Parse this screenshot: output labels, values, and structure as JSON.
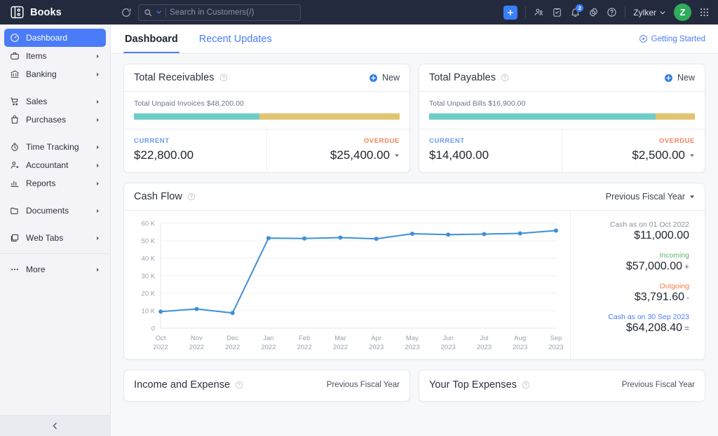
{
  "topbar": {
    "brand": "Books",
    "brand_logo_icon": "books-logo-icon",
    "refresh_icon": "refresh-icon",
    "search": {
      "placeholder": "Search in Customers(/)",
      "value": "",
      "search_icon": "search-icon",
      "dropdown_icon": "chevron-down-icon"
    },
    "add_icon": "plus-icon",
    "icons": [
      {
        "name": "contacts-icon"
      },
      {
        "name": "clipboard-icon"
      },
      {
        "name": "bell-icon",
        "badge": "2"
      },
      {
        "name": "settings-gear-icon"
      },
      {
        "name": "help-circle-icon"
      }
    ],
    "org_name": "Zylker",
    "org_caret_icon": "chevron-down-icon",
    "avatar_initial": "Z",
    "apps_grid_icon": "apps-grid-icon"
  },
  "sidebar": {
    "items": [
      {
        "label": "Dashboard",
        "icon": "gauge-icon",
        "active": true,
        "arrow": false,
        "gap_after": false
      },
      {
        "label": "Items",
        "icon": "briefcase-icon",
        "active": false,
        "arrow": true,
        "gap_after": false
      },
      {
        "label": "Banking",
        "icon": "bank-icon",
        "active": false,
        "arrow": true,
        "gap_after": true
      },
      {
        "label": "Sales",
        "icon": "cart-icon",
        "active": false,
        "arrow": true,
        "gap_after": false
      },
      {
        "label": "Purchases",
        "icon": "shopping-bag-icon",
        "active": false,
        "arrow": true,
        "gap_after": true
      },
      {
        "label": "Time Tracking",
        "icon": "stopwatch-icon",
        "active": false,
        "arrow": true,
        "gap_after": false
      },
      {
        "label": "Accountant",
        "icon": "user-plus-icon",
        "active": false,
        "arrow": true,
        "gap_after": false
      },
      {
        "label": "Reports",
        "icon": "bar-chart-icon",
        "active": false,
        "arrow": true,
        "gap_after": true
      },
      {
        "label": "Documents",
        "icon": "folder-icon",
        "active": false,
        "arrow": true,
        "gap_after": true
      },
      {
        "label": "Web Tabs",
        "icon": "window-icon",
        "active": false,
        "arrow": true,
        "gap_after": false
      }
    ],
    "more": {
      "label": "More",
      "icon": "ellipsis-icon",
      "arrow": true
    },
    "collapse_icon": "chevron-left-icon"
  },
  "tabs": {
    "items": [
      {
        "label": "Dashboard",
        "active": true
      },
      {
        "label": "Recent Updates",
        "active": false
      }
    ],
    "getting_started": {
      "label": "Getting Started",
      "icon": "play-circle-icon"
    }
  },
  "receivables": {
    "title": "Total Receivables",
    "help_icon": "help-circle-icon",
    "new_label": "New",
    "new_icon": "plus-circle-icon",
    "bar_label": "Total Unpaid Invoices $48,200.00",
    "bar_total": 48200,
    "current": {
      "label": "CURRENT",
      "value": "$22,800.00",
      "amount": 22800
    },
    "overdue": {
      "label": "OVERDUE",
      "value": "$25,400.00",
      "amount": 25400,
      "caret_icon": "chevron-down-icon"
    },
    "colors": {
      "current_bar": "#6ecdc8",
      "overdue_bar": "#e2c572",
      "current_text": "#6a9bf0",
      "overdue_text": "#f2845d"
    }
  },
  "payables": {
    "title": "Total Payables",
    "help_icon": "help-circle-icon",
    "new_label": "New",
    "new_icon": "plus-circle-icon",
    "bar_label": "Total Unpaid Bills $16,900.00",
    "bar_total": 16900,
    "current": {
      "label": "CURRENT",
      "value": "$14,400.00",
      "amount": 14400
    },
    "overdue": {
      "label": "OVERDUE",
      "value": "$2,500.00",
      "amount": 2500,
      "caret_icon": "chevron-down-icon"
    },
    "colors": {
      "current_bar": "#6ecdc8",
      "overdue_bar": "#e2c572"
    }
  },
  "cashflow": {
    "title": "Cash Flow",
    "help_icon": "help-circle-icon",
    "period": "Previous Fiscal Year",
    "period_caret_icon": "chevron-down-icon",
    "summary": {
      "opening_label": "Cash as on 01 Oct 2022",
      "opening_value": "$11,000.00",
      "incoming_label": "Incoming",
      "incoming_value": "$57,000.00",
      "incoming_sign": "+",
      "outgoing_label": "Outgoing",
      "outgoing_value": "$3,791.60",
      "outgoing_sign": "-",
      "closing_label": "Cash as on 30 Sep 2023",
      "closing_value": "$64,208.40",
      "closing_sign": "="
    }
  },
  "chart_data": {
    "type": "line",
    "title": "Cash Flow",
    "xlabel": "",
    "ylabel": "",
    "ylim": [
      0,
      60000
    ],
    "yticks": [
      0,
      10000,
      20000,
      30000,
      40000,
      50000,
      60000
    ],
    "ytick_labels": [
      "0",
      "10 K",
      "20 K",
      "30 K",
      "40 K",
      "50 K",
      "60 K"
    ],
    "grid": true,
    "legend": false,
    "line_color": "#3d90d7",
    "categories": [
      "Oct\n2022",
      "Nov\n2022",
      "Dec\n2022",
      "Jan\n2022",
      "Feb\n2022",
      "Mar\n2022",
      "Apr\n2023",
      "May\n2023",
      "Jun\n2023",
      "Jul\n2023",
      "Aug\n2023",
      "Sep\n2023"
    ],
    "tick_labels_top": [
      "Oct",
      "Nov",
      "Dec",
      "Jan",
      "Feb",
      "Mar",
      "Apr",
      "May",
      "Jun",
      "Jul",
      "Aug",
      "Sep"
    ],
    "tick_labels_bottom": [
      "2022",
      "2022",
      "2022",
      "2022",
      "2022",
      "2022",
      "2023",
      "2023",
      "2023",
      "2023",
      "2023",
      "2023"
    ],
    "series": [
      {
        "name": "Cash Flow",
        "values": [
          9500,
          11000,
          8700,
          51500,
          51300,
          51800,
          51100,
          54000,
          53500,
          53800,
          54200,
          55800,
          56000
        ]
      }
    ],
    "values": [
      9500,
      11000,
      8700,
      51500,
      51300,
      51800,
      51100,
      54000,
      53500,
      53800,
      55800,
      56000
    ]
  },
  "income_expense": {
    "title": "Income and Expense",
    "help_icon": "help-circle-icon",
    "period": "Previous Fiscal Year"
  },
  "top_expenses": {
    "title": "Your Top Expenses",
    "help_icon": "help-circle-icon",
    "period": "Previous Fiscal Year"
  }
}
